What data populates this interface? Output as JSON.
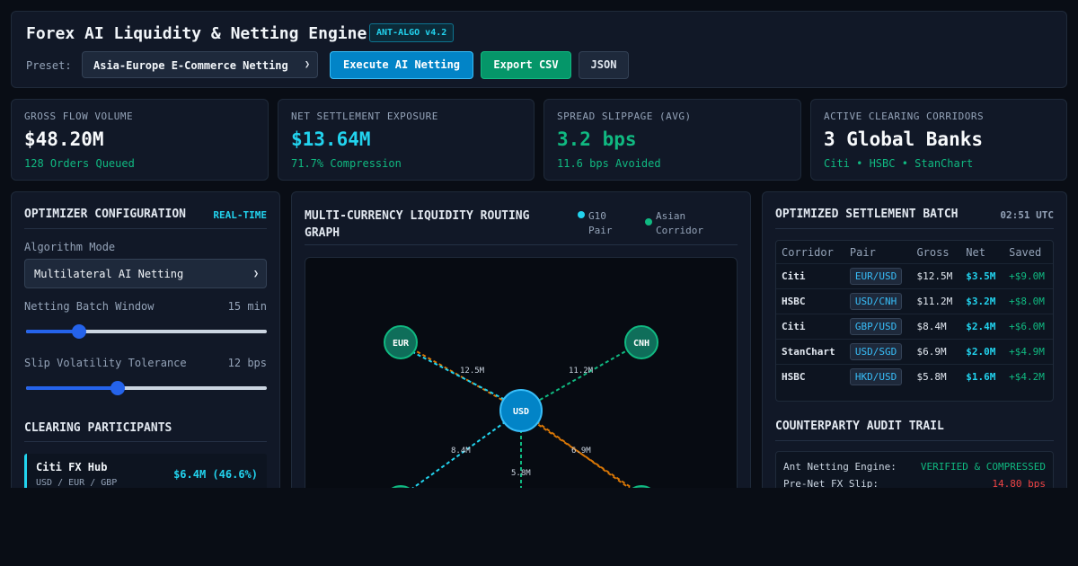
{
  "header": {
    "title": "Forex AI Liquidity & Netting Engine",
    "badge": "ANT-ALGO v4.2",
    "preset_label": "Preset:",
    "preset_value": "Asia-Europe E-Commerce Netting",
    "execute_label": "Execute AI Netting",
    "export_label": "Export CSV",
    "json_label": "JSON"
  },
  "kpis": [
    {
      "label": "GROSS FLOW VOLUME",
      "value": "$48.20M",
      "sub": "128 Orders Queued",
      "value_color": "#f8fafc"
    },
    {
      "label": "NET SETTLEMENT EXPOSURE",
      "value": "$13.64M",
      "sub": "71.7% Compression",
      "value_color": "#22d3ee"
    },
    {
      "label": "SPREAD SLIPPAGE (AVG)",
      "value": "3.2 bps",
      "sub": "11.6 bps Avoided",
      "value_color": "#10b981"
    },
    {
      "label": "ACTIVE CLEARING CORRIDORS",
      "value": "3 Global Banks",
      "sub": "Citi • HSBC • StanChart",
      "value_color": "#f8fafc"
    }
  ],
  "optimizer": {
    "title": "OPTIMIZER CONFIGURATION",
    "status": "REAL-TIME",
    "algo_label": "Algorithm Mode",
    "algo_value": "Multilateral AI Netting",
    "batch_label": "Netting Batch Window",
    "batch_value": "15 min",
    "batch_fraction": 0.22,
    "slip_label": "Slip Volatility Tolerance",
    "slip_value": "12 bps",
    "slip_fraction": 0.38,
    "participants_title": "CLEARING PARTICIPANTS",
    "participants": [
      {
        "name": "Citi FX Hub",
        "pairs": "USD / EUR / GBP",
        "amount": "$6.4M (46.6%)"
      }
    ]
  },
  "graph": {
    "title_line1": "MULTI-CURRENCY LIQUIDITY ROUTING",
    "title_line2": "GRAPH",
    "legend": [
      {
        "line1": "G10",
        "line2": "Pair",
        "color": "#22d3ee"
      },
      {
        "line1": "Asian",
        "line2": "Corridor",
        "color": "#10b981"
      }
    ],
    "nodes": {
      "eur": "EUR",
      "cnh": "CNH",
      "usd": "USD"
    },
    "edge_labels": {
      "eur": "12.5M",
      "cnh": "11.2M",
      "bl": "8.4M",
      "bm": "5.8M",
      "br": "6.9M"
    }
  },
  "settlement": {
    "title": "OPTIMIZED SETTLEMENT BATCH",
    "time": "02:51 UTC",
    "columns": [
      "Corridor",
      "Pair",
      "Gross",
      "Net",
      "Saved"
    ],
    "rows": [
      {
        "corridor": "Citi",
        "pair": "EUR/USD",
        "gross": "$12.5M",
        "net": "$3.5M",
        "saved": "+$9.0M"
      },
      {
        "corridor": "HSBC",
        "pair": "USD/CNH",
        "gross": "$11.2M",
        "net": "$3.2M",
        "saved": "+$8.0M"
      },
      {
        "corridor": "Citi",
        "pair": "GBP/USD",
        "gross": "$8.4M",
        "net": "$2.4M",
        "saved": "+$6.0M"
      },
      {
        "corridor": "StanChart",
        "pair": "USD/SGD",
        "gross": "$6.9M",
        "net": "$2.0M",
        "saved": "+$4.9M"
      },
      {
        "corridor": "HSBC",
        "pair": "HKD/USD",
        "gross": "$5.8M",
        "net": "$1.6M",
        "saved": "+$4.2M"
      }
    ]
  },
  "audit": {
    "title": "COUNTERPARTY AUDIT TRAIL",
    "lines": [
      {
        "label": "Ant Netting Engine:",
        "value": "VERIFIED & COMPRESSED",
        "color": "#10b981"
      },
      {
        "label": "Pre-Net FX Slip:",
        "value": "14.80 bps",
        "color": "#ef4444"
      }
    ]
  },
  "colors": {
    "accent": "#22d3ee",
    "positive": "#10b981",
    "negative": "#ef4444",
    "usd_node": "#0284c7",
    "asia_node": "#0f6e5a",
    "route": "#d97706"
  }
}
